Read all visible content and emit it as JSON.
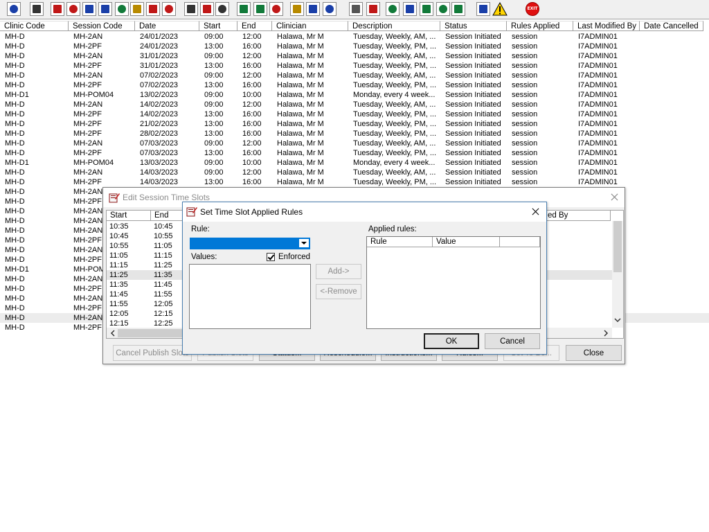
{
  "toolbar": {
    "icons": [
      "person-icon",
      "printer-icon",
      "book-icon",
      "book-edit-icon",
      "calendar-icon",
      "mail-icon",
      "doctor-icon",
      "notepad-icon",
      "flag-icon",
      "flag-alt-icon",
      "search-list-icon",
      "clock-icon",
      "screen-icon",
      "chart-icon",
      "chart-alt-icon",
      "dial-icon",
      "note-icon",
      "bed-icon",
      "transfer-icon",
      "document-icon",
      "bar-chart-icon",
      "globe-icon",
      "check-down-icon",
      "download-icon",
      "check-icon",
      "refresh-icon",
      "swap-icon",
      "warning-icon",
      "exit-icon"
    ],
    "exit_label": "EXIT"
  },
  "grid": {
    "columns": [
      "Clinic Code",
      "Session Code",
      "Date",
      "Start",
      "End",
      "Clinician",
      "Description",
      "Status",
      "Rules Applied",
      "Last Modified By",
      "Date Cancelled"
    ],
    "rows": [
      [
        "MH-D",
        "MH-2AN",
        "24/01/2023",
        "09:00",
        "12:00",
        "Halawa, Mr M",
        "Tuesday, Weekly, AM, ...",
        "Session Initiated",
        "session",
        "I7ADMIN01"
      ],
      [
        "MH-D",
        "MH-2PF",
        "24/01/2023",
        "13:00",
        "16:00",
        "Halawa, Mr M",
        "Tuesday, Weekly, PM, ...",
        "Session Initiated",
        "session",
        "I7ADMIN01"
      ],
      [
        "MH-D",
        "MH-2AN",
        "31/01/2023",
        "09:00",
        "12:00",
        "Halawa, Mr M",
        "Tuesday, Weekly, AM, ...",
        "Session Initiated",
        "session",
        "I7ADMIN01"
      ],
      [
        "MH-D",
        "MH-2PF",
        "31/01/2023",
        "13:00",
        "16:00",
        "Halawa, Mr M",
        "Tuesday, Weekly, PM, ...",
        "Session Initiated",
        "session",
        "I7ADMIN01"
      ],
      [
        "MH-D",
        "MH-2AN",
        "07/02/2023",
        "09:00",
        "12:00",
        "Halawa, Mr M",
        "Tuesday, Weekly, AM, ...",
        "Session Initiated",
        "session",
        "I7ADMIN01"
      ],
      [
        "MH-D",
        "MH-2PF",
        "07/02/2023",
        "13:00",
        "16:00",
        "Halawa, Mr M",
        "Tuesday, Weekly, PM, ...",
        "Session Initiated",
        "session",
        "I7ADMIN01"
      ],
      [
        "MH-D1",
        "MH-POM04",
        "13/02/2023",
        "09:00",
        "10:00",
        "Halawa, Mr M",
        "Monday, every 4 week...",
        "Session Initiated",
        "session",
        "I7ADMIN01"
      ],
      [
        "MH-D",
        "MH-2AN",
        "14/02/2023",
        "09:00",
        "12:00",
        "Halawa, Mr M",
        "Tuesday, Weekly, AM, ...",
        "Session Initiated",
        "session",
        "I7ADMIN01"
      ],
      [
        "MH-D",
        "MH-2PF",
        "14/02/2023",
        "13:00",
        "16:00",
        "Halawa, Mr M",
        "Tuesday, Weekly, PM, ...",
        "Session Initiated",
        "session",
        "I7ADMIN01"
      ],
      [
        "MH-D",
        "MH-2PF",
        "21/02/2023",
        "13:00",
        "16:00",
        "Halawa, Mr M",
        "Tuesday, Weekly, PM, ...",
        "Session Initiated",
        "session",
        "I7ADMIN01"
      ],
      [
        "MH-D",
        "MH-2PF",
        "28/02/2023",
        "13:00",
        "16:00",
        "Halawa, Mr M",
        "Tuesday, Weekly, PM, ...",
        "Session Initiated",
        "session",
        "I7ADMIN01"
      ],
      [
        "MH-D",
        "MH-2AN",
        "07/03/2023",
        "09:00",
        "12:00",
        "Halawa, Mr M",
        "Tuesday, Weekly, AM, ...",
        "Session Initiated",
        "session",
        "I7ADMIN01"
      ],
      [
        "MH-D",
        "MH-2PF",
        "07/03/2023",
        "13:00",
        "16:00",
        "Halawa, Mr M",
        "Tuesday, Weekly, PM, ...",
        "Session Initiated",
        "session",
        "I7ADMIN01"
      ],
      [
        "MH-D1",
        "MH-POM04",
        "13/03/2023",
        "09:00",
        "10:00",
        "Halawa, Mr M",
        "Monday, every 4 week...",
        "Session Initiated",
        "session",
        "I7ADMIN01"
      ],
      [
        "MH-D",
        "MH-2AN",
        "14/03/2023",
        "09:00",
        "12:00",
        "Halawa, Mr M",
        "Tuesday, Weekly, AM, ...",
        "Session Initiated",
        "session",
        "I7ADMIN01"
      ],
      [
        "MH-D",
        "MH-2PF",
        "14/03/2023",
        "13:00",
        "16:00",
        "Halawa, Mr M",
        "Tuesday, Weekly, PM, ...",
        "Session Initiated",
        "session",
        "I7ADMIN01"
      ],
      [
        "MH-D",
        "MH-2AN"
      ],
      [
        "MH-D",
        "MH-2PF"
      ],
      [
        "MH-D",
        "MH-2AN"
      ],
      [
        "MH-D",
        "MH-2AN"
      ],
      [
        "MH-D",
        "MH-2AN"
      ],
      [
        "MH-D",
        "MH-2PF"
      ],
      [
        "MH-D",
        "MH-2AN"
      ],
      [
        "MH-D",
        "MH-2PF"
      ],
      [
        "MH-D1",
        "MH-POM"
      ],
      [
        "MH-D",
        "MH-2AN"
      ],
      [
        "MH-D",
        "MH-2PF"
      ],
      [
        "MH-D",
        "MH-2AN"
      ],
      [
        "MH-D",
        "MH-2PF"
      ],
      [
        "MH-D",
        "MH-2AN"
      ],
      [
        "MH-D",
        "MH-2PF"
      ]
    ],
    "selected_row": 29
  },
  "edit_dialog": {
    "title": "Edit Session Time Slots",
    "columns": [
      "Start",
      "End"
    ],
    "partial_header": "ed By",
    "rows": [
      [
        "10:35",
        "10:45"
      ],
      [
        "10:45",
        "10:55"
      ],
      [
        "10:55",
        "11:05"
      ],
      [
        "11:05",
        "11:15"
      ],
      [
        "11:15",
        "11:25"
      ],
      [
        "11:25",
        "11:35"
      ],
      [
        "11:35",
        "11:45"
      ],
      [
        "11:45",
        "11:55"
      ],
      [
        "11:55",
        "12:05"
      ],
      [
        "12:05",
        "12:15"
      ],
      [
        "12:15",
        "12:25"
      ]
    ],
    "selected_row": 5,
    "buttons": {
      "cancel_publish": "Cancel Publish Slots",
      "publish": "Publish Slots",
      "status": "Status...",
      "reschedule": "Reschedule...",
      "instructions": "Instructions...",
      "rules": "Rules...",
      "set_to_be": "Set To Be...",
      "close": "Close"
    }
  },
  "rules_dialog": {
    "title": "Set Time Slot Applied Rules",
    "rule_label": "Rule:",
    "values_label": "Values:",
    "enforced_label": "Enforced",
    "enforced_checked": true,
    "applied_label": "Applied rules:",
    "applied_columns": [
      "Rule",
      "Value"
    ],
    "add_button": "Add->",
    "remove_button": "<-Remove",
    "ok_button": "OK",
    "cancel_button": "Cancel"
  }
}
